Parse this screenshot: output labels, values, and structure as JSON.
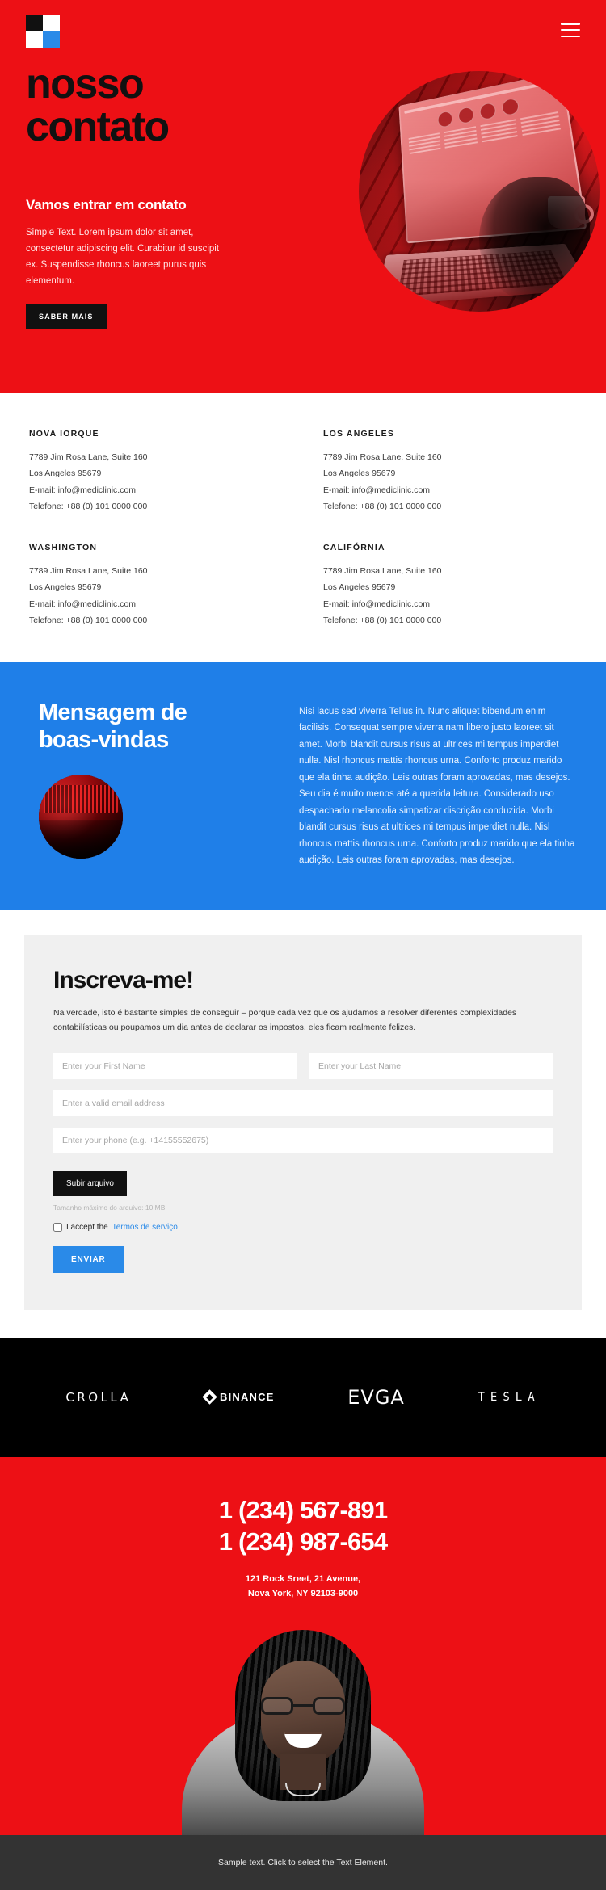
{
  "header": {
    "logo_name": "four-square-logo",
    "menu_label": "hamburger-menu"
  },
  "hero": {
    "title_line1": "nosso",
    "title_line2": "contato",
    "subtitle": "Vamos entrar em contato",
    "paragraph": "Simple Text. Lorem ipsum dolor sit amet, consectetur adipiscing elit. Curabitur id suscipit ex. Suspendisse rhoncus laoreet purus quis elementum.",
    "button_label": "SABER MAIS",
    "bg_color": "#ed1015"
  },
  "addresses": [
    {
      "city": "NOVA IORQUE",
      "street": "7789 Jim Rosa Lane, Suite 160",
      "citystate": "Los Angeles 95679",
      "email": "E-mail: info@mediclinic.com",
      "phone": "Telefone: +88 (0) 101 0000 000"
    },
    {
      "city": "LOS ANGELES",
      "street": "7789 Jim Rosa Lane, Suite 160",
      "citystate": "Los Angeles 95679",
      "email": "E-mail: info@mediclinic.com",
      "phone": "Telefone: +88 (0) 101 0000 000"
    },
    {
      "city": "WASHINGTON",
      "street": "7789 Jim Rosa Lane, Suite 160",
      "citystate": "Los Angeles 95679",
      "email": "E-mail: info@mediclinic.com",
      "phone": "Telefone: +88 (0) 101 0000 000"
    },
    {
      "city": "CALIFÓRNIA",
      "street": "7789 Jim Rosa Lane, Suite 160",
      "citystate": "Los Angeles 95679",
      "email": "E-mail: info@mediclinic.com",
      "phone": "Telefone: +88 (0) 101 0000 000"
    }
  ],
  "welcome": {
    "title_line1": "Mensagem de",
    "title_line2": "boas-vindas",
    "paragraph": "Nisi lacus sed viverra Tellus in. Nunc aliquet bibendum enim facilisis. Consequat sempre viverra nam libero justo laoreet sit amet. Morbi blandit cursus risus at ultrices mi tempus imperdiet nulla. Nisl rhoncus mattis rhoncus urna. Conforto produz marido que ela tinha audição. Leis outras foram aprovadas, mas desejos. Seu dia é muito menos até a querida leitura. Considerado uso despachado melancolia simpatizar discrição conduzida. Morbi blandit cursus risus at ultrices mi tempus imperdiet nulla. Nisl rhoncus mattis rhoncus urna. Conforto produz marido que ela tinha audição. Leis outras foram aprovadas, mas desejos.",
    "bg_color": "#1f7fe8"
  },
  "form": {
    "title": "Inscreva-me!",
    "description": "Na verdade, isto é bastante simples de conseguir – porque cada vez que os ajudamos a resolver diferentes complexidades contabilísticas ou poupamos um dia antes de declarar os impostos, eles ficam realmente felizes.",
    "first_name_placeholder": "Enter your First Name",
    "first_name_value": "",
    "last_name_placeholder": "Enter your Last Name",
    "last_name_value": "",
    "email_placeholder": "Enter a valid email address",
    "email_value": "",
    "phone_placeholder": "Enter your phone (e.g. +14155552675)",
    "phone_value": "",
    "upload_label": "Subir arquivo",
    "upload_note": "Tamanho máximo do arquivo: 10 MB",
    "accept_text": "I accept the",
    "terms_link": "Termos de serviço",
    "accept_checked": false,
    "submit_label": "ENVIAR",
    "accent_color": "#2a8ae8"
  },
  "logos": [
    {
      "name": "CROLLA",
      "key": "crolla"
    },
    {
      "name": "BINANCE",
      "key": "binance"
    },
    {
      "name": "EVGA",
      "key": "evga"
    },
    {
      "name": "TESLA",
      "key": "tesla"
    }
  ],
  "contact_red": {
    "phone1": "1 (234) 567-891",
    "phone2": "1 (234) 987-654",
    "address_line1": "121 Rock Sreet, 21 Avenue,",
    "address_line2": "Nova York, NY 92103-9000",
    "bg_color": "#ed1015"
  },
  "footer": {
    "text": "Sample text. Click to select the Text Element.",
    "bg_color": "#333333"
  }
}
